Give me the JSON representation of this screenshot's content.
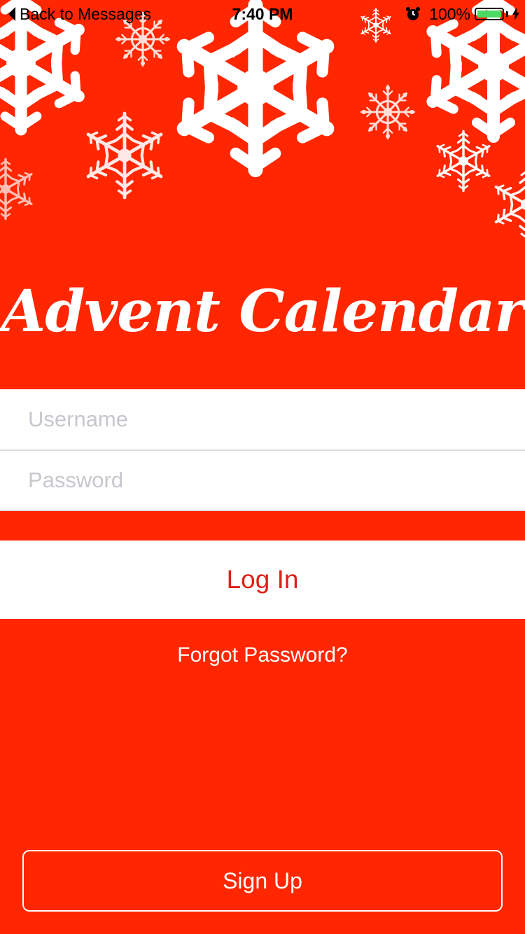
{
  "status_bar": {
    "back_label": "Back to Messages",
    "time": "7:40 PM",
    "battery_percent": "100%",
    "battery_level": 1.0,
    "icons": [
      "back-chevron-icon",
      "alarm-icon",
      "battery-icon",
      "charging-icon"
    ]
  },
  "header": {
    "decoration": "snowflakes",
    "title": "Advent Calendar"
  },
  "form": {
    "username_placeholder": "Username",
    "username_value": "",
    "password_placeholder": "Password",
    "password_value": ""
  },
  "actions": {
    "login_label": "Log In",
    "forgot_label": "Forgot Password?",
    "signup_label": "Sign Up"
  },
  "colors": {
    "background": "#ff2600",
    "login_text": "#e01f17",
    "placeholder": "#c7c7cd",
    "battery_fill": "#4cd964"
  }
}
